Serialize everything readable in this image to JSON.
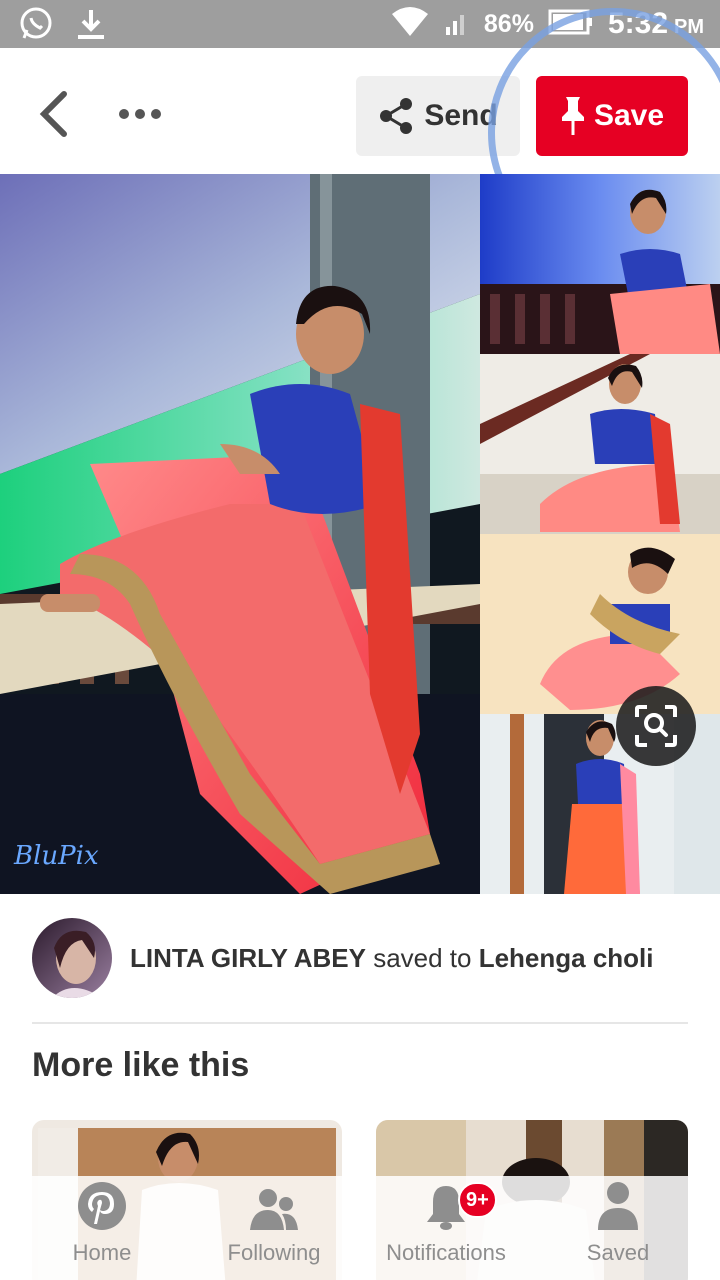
{
  "status_bar": {
    "battery_percent": "86%",
    "time": "5:32",
    "ampm": "PM",
    "icons": [
      "whatsapp-icon",
      "download-icon",
      "wifi-icon",
      "signal-icon",
      "battery-icon"
    ]
  },
  "header": {
    "back_icon": "chevron-left-icon",
    "more_icon": "ellipsis-icon",
    "send_label": "Send",
    "save_label": "Save"
  },
  "pin": {
    "watermark": "BluPix"
  },
  "attribution": {
    "user": "LINTA GIRLY ABEY",
    "connector": " saved to ",
    "board": "Lehenga choli"
  },
  "more_like_this": {
    "title": "More like this"
  },
  "bottom_nav": {
    "items": [
      {
        "label": "Home",
        "icon": "pinterest-logo-icon"
      },
      {
        "label": "Following",
        "icon": "people-icon"
      },
      {
        "label": "Notifications",
        "icon": "bell-icon",
        "badge": "9+"
      },
      {
        "label": "Saved",
        "icon": "person-icon"
      }
    ]
  },
  "colors": {
    "accent": "#e60023",
    "status_bar": "#9e9e9e",
    "ring": "#78a0e1"
  }
}
